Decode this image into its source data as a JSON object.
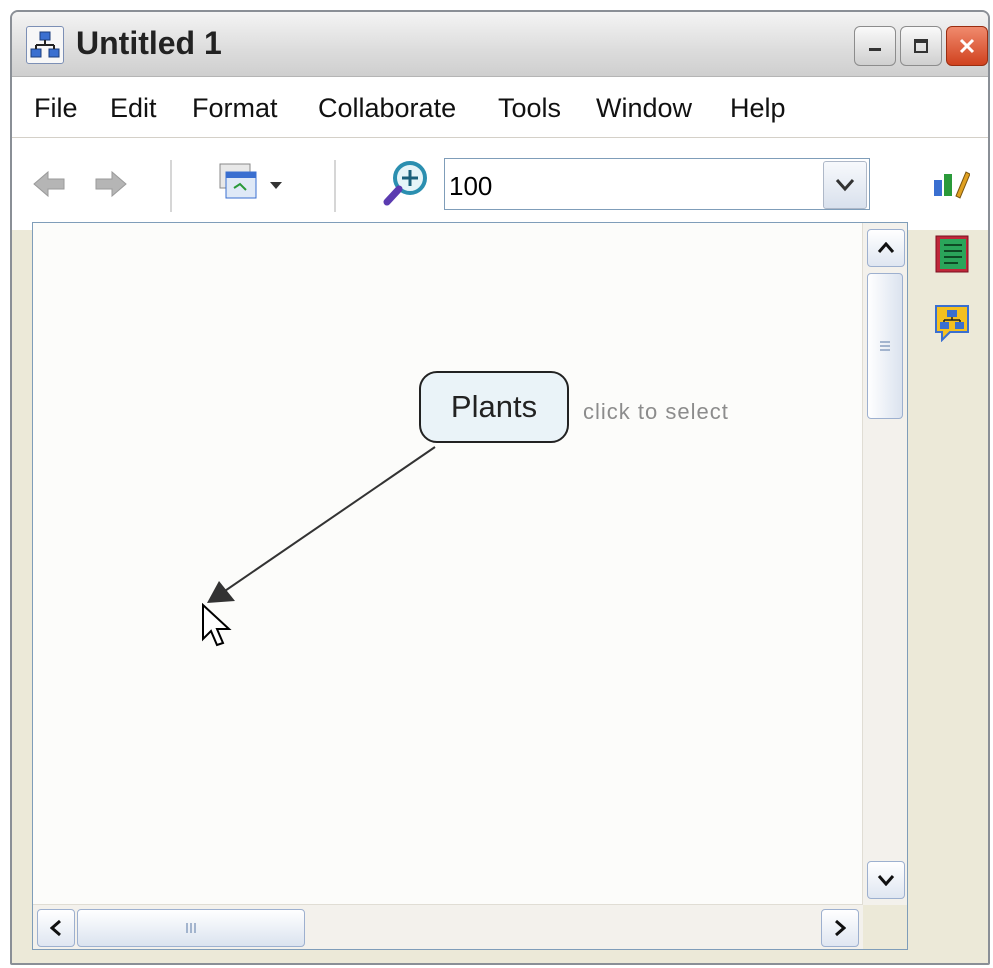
{
  "window": {
    "title": "Untitled 1"
  },
  "menu": {
    "items": [
      "File",
      "Edit",
      "Format",
      "Collaborate",
      "Tools",
      "Window",
      "Help"
    ]
  },
  "toolbar": {
    "zoom_value": "100"
  },
  "canvas": {
    "concept_label": "Plants",
    "hint_text": "click to select"
  },
  "colors": {
    "accent": "#2e6ac9",
    "close_button": "#d0421f",
    "concept_fill": "#eaf3f8"
  }
}
